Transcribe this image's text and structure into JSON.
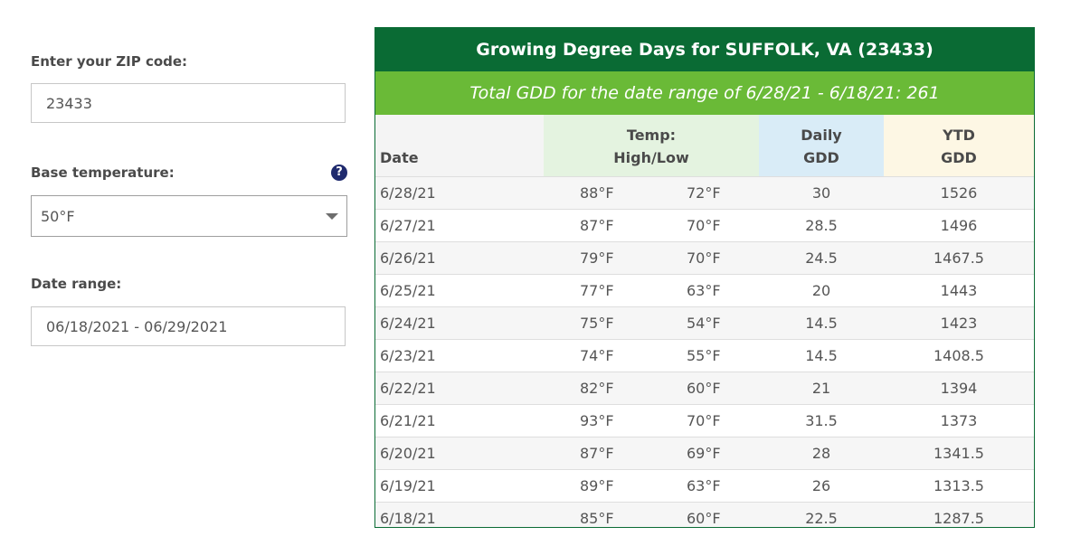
{
  "form": {
    "zip_label": "Enter your ZIP code:",
    "zip_value": "23433",
    "base_label": "Base temperature:",
    "base_value": "50°F",
    "help_glyph": "?",
    "range_label": "Date range:",
    "range_value": "06/18/2021 - 06/29/2021"
  },
  "table": {
    "title": "Growing Degree Days for SUFFOLK, VA (23433)",
    "subtitle": "Total GDD for the date range of 6/28/21 - 6/18/21: 261",
    "headers": {
      "date": "Date",
      "temp_line1": "Temp:",
      "temp_line2": "High/Low",
      "daily_line1": "Daily",
      "daily_line2": "GDD",
      "ytd_line1": "YTD",
      "ytd_line2": "GDD"
    },
    "rows": [
      {
        "date": "6/28/21",
        "high": "88°F",
        "low": "72°F",
        "daily": "30",
        "ytd": "1526"
      },
      {
        "date": "6/27/21",
        "high": "87°F",
        "low": "70°F",
        "daily": "28.5",
        "ytd": "1496"
      },
      {
        "date": "6/26/21",
        "high": "79°F",
        "low": "70°F",
        "daily": "24.5",
        "ytd": "1467.5"
      },
      {
        "date": "6/25/21",
        "high": "77°F",
        "low": "63°F",
        "daily": "20",
        "ytd": "1443"
      },
      {
        "date": "6/24/21",
        "high": "75°F",
        "low": "54°F",
        "daily": "14.5",
        "ytd": "1423"
      },
      {
        "date": "6/23/21",
        "high": "74°F",
        "low": "55°F",
        "daily": "14.5",
        "ytd": "1408.5"
      },
      {
        "date": "6/22/21",
        "high": "82°F",
        "low": "60°F",
        "daily": "21",
        "ytd": "1394"
      },
      {
        "date": "6/21/21",
        "high": "93°F",
        "low": "70°F",
        "daily": "31.5",
        "ytd": "1373"
      },
      {
        "date": "6/20/21",
        "high": "87°F",
        "low": "69°F",
        "daily": "28",
        "ytd": "1341.5"
      },
      {
        "date": "6/19/21",
        "high": "89°F",
        "low": "63°F",
        "daily": "26",
        "ytd": "1313.5"
      },
      {
        "date": "6/18/21",
        "high": "85°F",
        "low": "60°F",
        "daily": "22.5",
        "ytd": "1287.5"
      }
    ]
  },
  "colors": {
    "title_bg": "#0a6b34",
    "subtitle_bg": "#6aba37",
    "help_icon": "#1f2a6e",
    "temp_header_bg": "#e4f3e0",
    "daily_header_bg": "#d9ecf7",
    "ytd_header_bg": "#fdf7e4"
  },
  "icons": {
    "help": "question-circle-icon",
    "dropdown": "caret-down-icon"
  }
}
